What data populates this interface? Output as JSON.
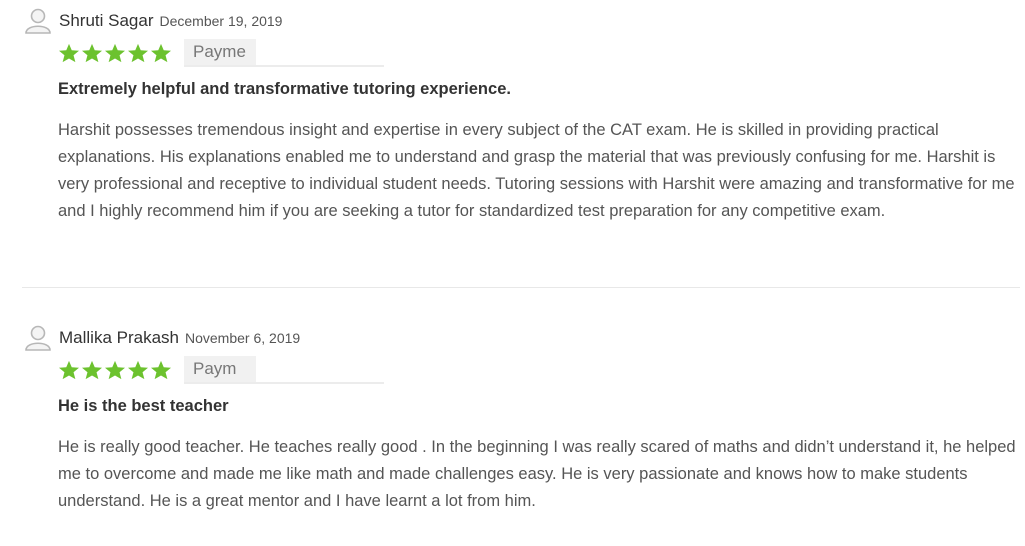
{
  "reviews": [
    {
      "name": "Shruti Sagar",
      "date": "December 19, 2019",
      "rating": 5,
      "tag_label": "Payme",
      "title": "Extremely helpful and transformative tutoring experience.",
      "body": "Harshit possesses tremendous insight and expertise in every subject of the CAT exam. He is skilled in providing practical explanations. His explanations enabled me to understand and grasp the material that was previously confusing for me. Harshit is very professional and receptive to individual student needs. Tutoring sessions with Harshit were amazing and transformative for me and I highly recommend him if you are seeking a tutor for standardized test preparation for any competitive exam."
    },
    {
      "name": "Mallika Prakash",
      "date": "November 6, 2019",
      "rating": 5,
      "tag_label": "Paym",
      "title": "He is the best teacher",
      "body": "He is really good teacher. He teaches really good . In the beginning I was really scared of maths and didn’t understand it, he helped me to overcome and made me like math and made challenges easy. He is very passionate and knows how to make students understand. He is a great mentor and I have learnt a lot from him."
    }
  ],
  "colors": {
    "star": "#6cc22e",
    "avatar": "#b7b7b7"
  },
  "icons": {
    "avatar": "user-avatar-icon",
    "star": "star-icon"
  }
}
